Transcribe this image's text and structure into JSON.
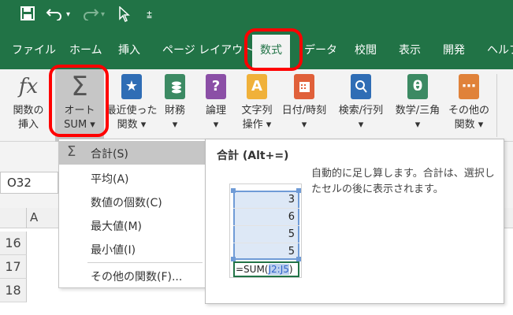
{
  "quick_access": {
    "more_glyph": "⩲"
  },
  "tabs": [
    "ファイル",
    "ホーム",
    "挿入",
    "ページ レイアウト",
    "数式",
    "データ",
    "校閲",
    "表示",
    "開発",
    "ヘルプ"
  ],
  "ribbon": {
    "insert_function": {
      "glyph": "fx",
      "line1": "関数の",
      "line2": "挿入"
    },
    "autosum": {
      "glyph": "Σ",
      "line1": "オート",
      "line2": "SUM ▾"
    },
    "recent": {
      "glyph": "★",
      "line1": "最近使った",
      "line2": "関数 ▾"
    },
    "financial": {
      "label": "財務",
      "arrow": "▾"
    },
    "logical": {
      "glyph": "?",
      "label": "論理",
      "arrow": "▾"
    },
    "text": {
      "glyph": "A",
      "line1": "文字列",
      "line2": "操作 ▾"
    },
    "datetime": {
      "label": "日付/時刻",
      "arrow": "▾"
    },
    "lookup": {
      "label": "検索/行列",
      "arrow": "▾"
    },
    "math": {
      "glyph": "θ",
      "label": "数学/三角",
      "arrow": "▾"
    },
    "more": {
      "glyph": "⋯",
      "line1": "その他の",
      "line2": "関数 ▾"
    }
  },
  "name_box": {
    "value": "O32"
  },
  "column_header": "A",
  "rows": [
    "16",
    "17",
    "18"
  ],
  "menu": {
    "sigma": "Σ",
    "items": [
      "合計(S)",
      "平均(A)",
      "数値の個数(C)",
      "最大値(M)",
      "最小値(I)",
      "その他の関数(F)..."
    ]
  },
  "tooltip": {
    "title": "合計 (Alt+=)",
    "description": "自動的に足し算します。合計は、選択したセルの後に表示されます。",
    "values": [
      "3",
      "6",
      "5",
      "5"
    ],
    "formula_prefix": "=SUM(",
    "formula_ref": "J2:J5",
    "formula_suffix": ")"
  },
  "colors": {
    "brand": "#217346",
    "highlight_ring": "#ff0000"
  }
}
